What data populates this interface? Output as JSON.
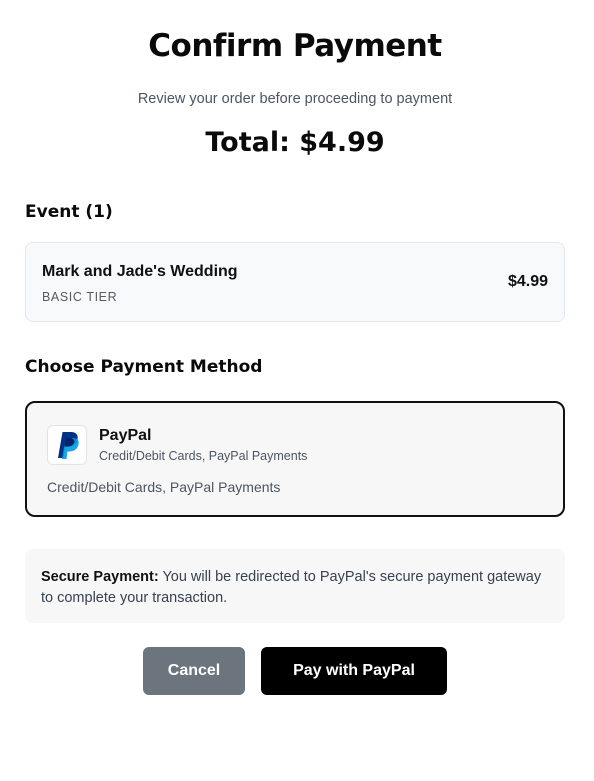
{
  "header": {
    "title": "Confirm Payment",
    "subtitle": "Review your order before proceeding to payment",
    "total": "Total: $4.99"
  },
  "events": {
    "heading": "Event (1)",
    "items": [
      {
        "name": "Mark and Jade's Wedding",
        "tier": "BASIC TIER",
        "price": "$4.99"
      }
    ]
  },
  "payment": {
    "heading": "Choose Payment Method",
    "methods": [
      {
        "name": "PayPal",
        "subtitle": "Credit/Debit Cards, PayPal Payments",
        "description": "Credit/Debit Cards, PayPal Payments",
        "icon": "paypal-logo-icon",
        "selected": true
      }
    ]
  },
  "notice": {
    "label": "Secure Payment:",
    "text": " You will be redirected to PayPal's secure payment gateway to complete your transaction."
  },
  "actions": {
    "cancel_label": "Cancel",
    "pay_label": "Pay with PayPal"
  },
  "colors": {
    "cancel_button": "#6c757d",
    "pay_button": "#000000",
    "paypal_dark_blue": "#003087",
    "paypal_light_blue": "#009cde"
  }
}
